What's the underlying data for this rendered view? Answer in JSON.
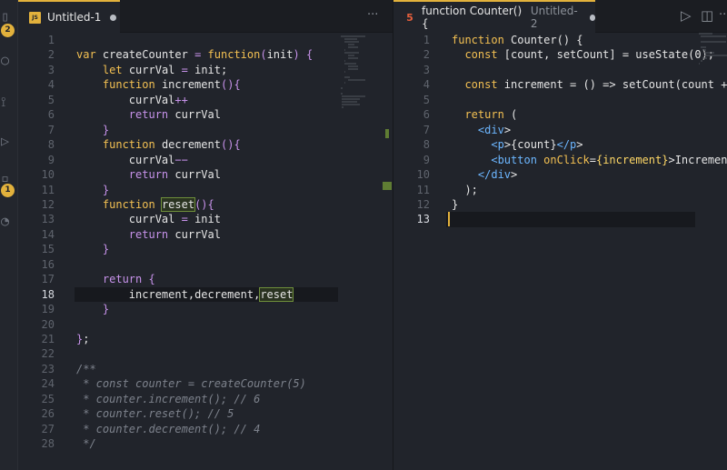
{
  "activity_bar": {
    "icons": [
      "files-icon",
      "search-icon",
      "source-control-icon",
      "run-icon",
      "extensions-icon",
      "remote-icon"
    ],
    "badges": [
      "2",
      "1"
    ]
  },
  "left_editor": {
    "tab": {
      "icon_text": "JS",
      "title": "Untitled-1",
      "dirty": true
    },
    "more_actions_label": "···",
    "current_line": 18,
    "lines": [
      "",
      "var createCounter = function(init) {",
      "    let currVal = init;",
      "    function increment(){",
      "        currVal++",
      "        return currVal",
      "    }",
      "    function decrement(){",
      "        currVal−−",
      "        return currVal",
      "    }",
      "    function reset(){",
      "        currVal = init",
      "        return currVal",
      "    }",
      "",
      "    return {",
      "        increment,decrement,reset",
      "    }",
      "",
      "};",
      "",
      "/**",
      " * const counter = createCounter(5)",
      " * counter.increment(); // 6",
      " * counter.reset(); // 5",
      " * counter.decrement(); // 4",
      " */"
    ]
  },
  "right_editor": {
    "tab": {
      "icon_text": "5",
      "title": "function Counter() {",
      "description": "Untitled-2",
      "dirty": true
    },
    "run_label": "▷",
    "split_label": "◫",
    "more_actions_label": "···",
    "current_line": 13,
    "lines": [
      "function Counter() {",
      "  const [count, setCount] = useState(0);",
      "",
      "  const increment = () => setCount(count +",
      "",
      "  return (",
      "    <div>",
      "      <p>{count}</p>",
      "      <button onClick={increment}>Incremen",
      "    </div>",
      "  );",
      "}",
      ""
    ]
  }
}
